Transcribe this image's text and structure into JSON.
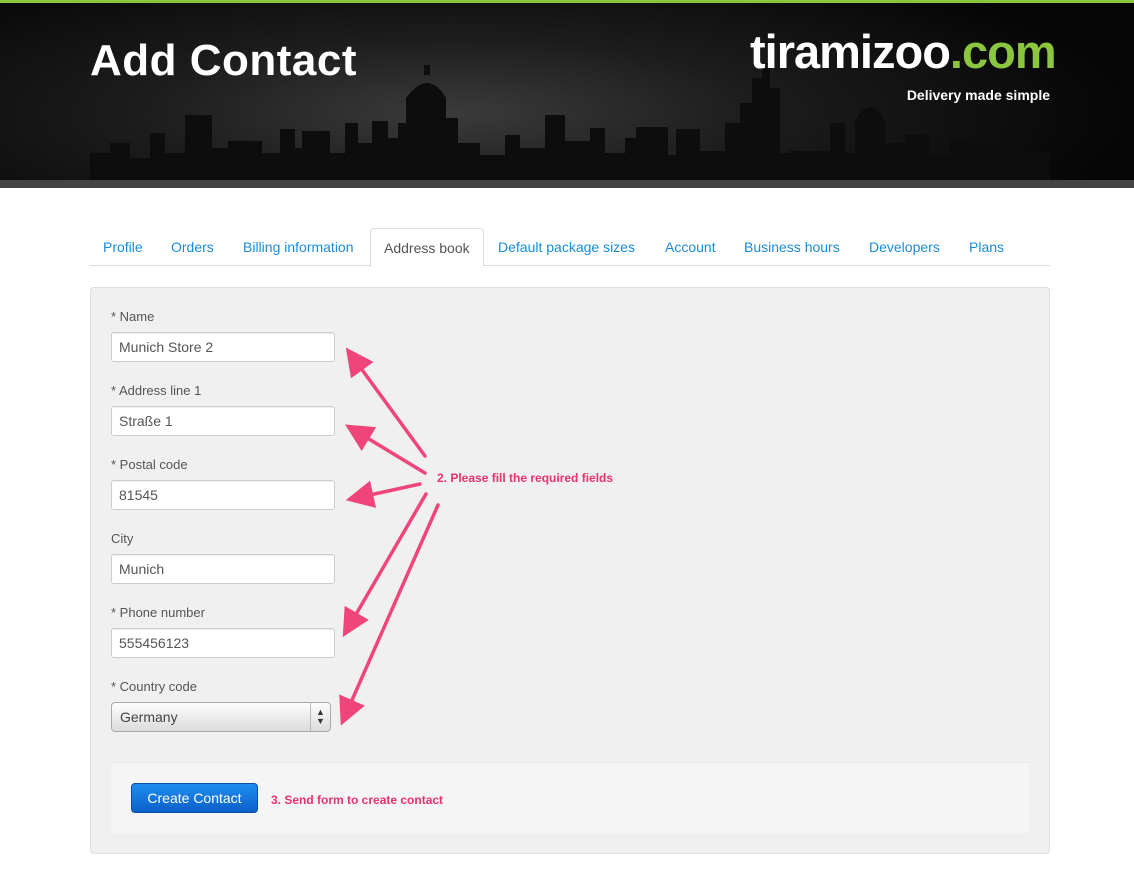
{
  "header": {
    "title": "Add Contact",
    "logo_part1": "tiramizoo",
    "logo_part2": ".com",
    "tagline": "Delivery made simple"
  },
  "tabs": [
    {
      "label": "Profile",
      "active": false
    },
    {
      "label": "Orders",
      "active": false
    },
    {
      "label": "Billing information",
      "active": false
    },
    {
      "label": "Address book",
      "active": true
    },
    {
      "label": "Default package sizes",
      "active": false
    },
    {
      "label": "Account",
      "active": false
    },
    {
      "label": "Business hours",
      "active": false
    },
    {
      "label": "Developers",
      "active": false
    },
    {
      "label": "Plans",
      "active": false
    }
  ],
  "form": {
    "name": {
      "label": "* Name",
      "value": "Munich Store 2"
    },
    "address1": {
      "label": "* Address line 1",
      "value": "Straße 1"
    },
    "postal": {
      "label": "* Postal code",
      "value": "81545"
    },
    "city": {
      "label": "City",
      "value": "Munich"
    },
    "phone": {
      "label": "* Phone number",
      "value": "555456123"
    },
    "country": {
      "label": "* Country code",
      "value": "Germany"
    },
    "submit_label": "Create Contact"
  },
  "annotations": {
    "fill_fields": "2. Please fill the required fields",
    "send_form": "3. Send form to create contact",
    "color": "#e8336b"
  },
  "colors": {
    "brand_green": "#8cc63e",
    "link_blue": "#1a8cd8",
    "button_blue": "#0b6fd8"
  }
}
